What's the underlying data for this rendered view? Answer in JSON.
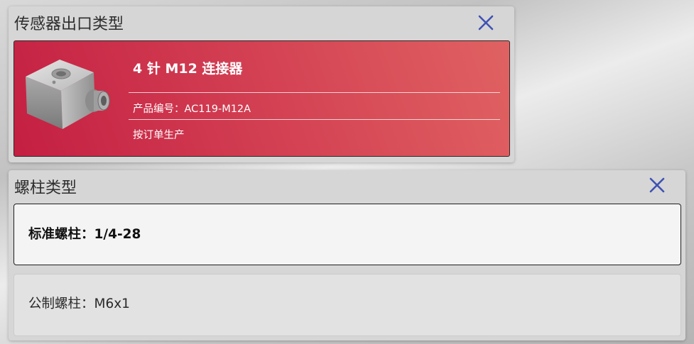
{
  "sensor_output_panel": {
    "title": "传感器出口类型",
    "selected": {
      "name": "4 针 M12 连接器",
      "part_label": "产品编号：",
      "part_number": "AC119-M12A",
      "availability": "按订单生产"
    }
  },
  "stud_panel": {
    "title": "螺柱类型",
    "options": [
      {
        "label": "标准螺柱：1/4-28",
        "selected": true
      },
      {
        "label": "公制螺柱：M6x1",
        "selected": false
      }
    ]
  },
  "icons": {
    "close": "close-icon",
    "sensor": "sensor-product-image"
  },
  "colors": {
    "accent_close": "#3f52b5",
    "card_red_start": "#c41f42",
    "card_red_end": "#e06262"
  }
}
